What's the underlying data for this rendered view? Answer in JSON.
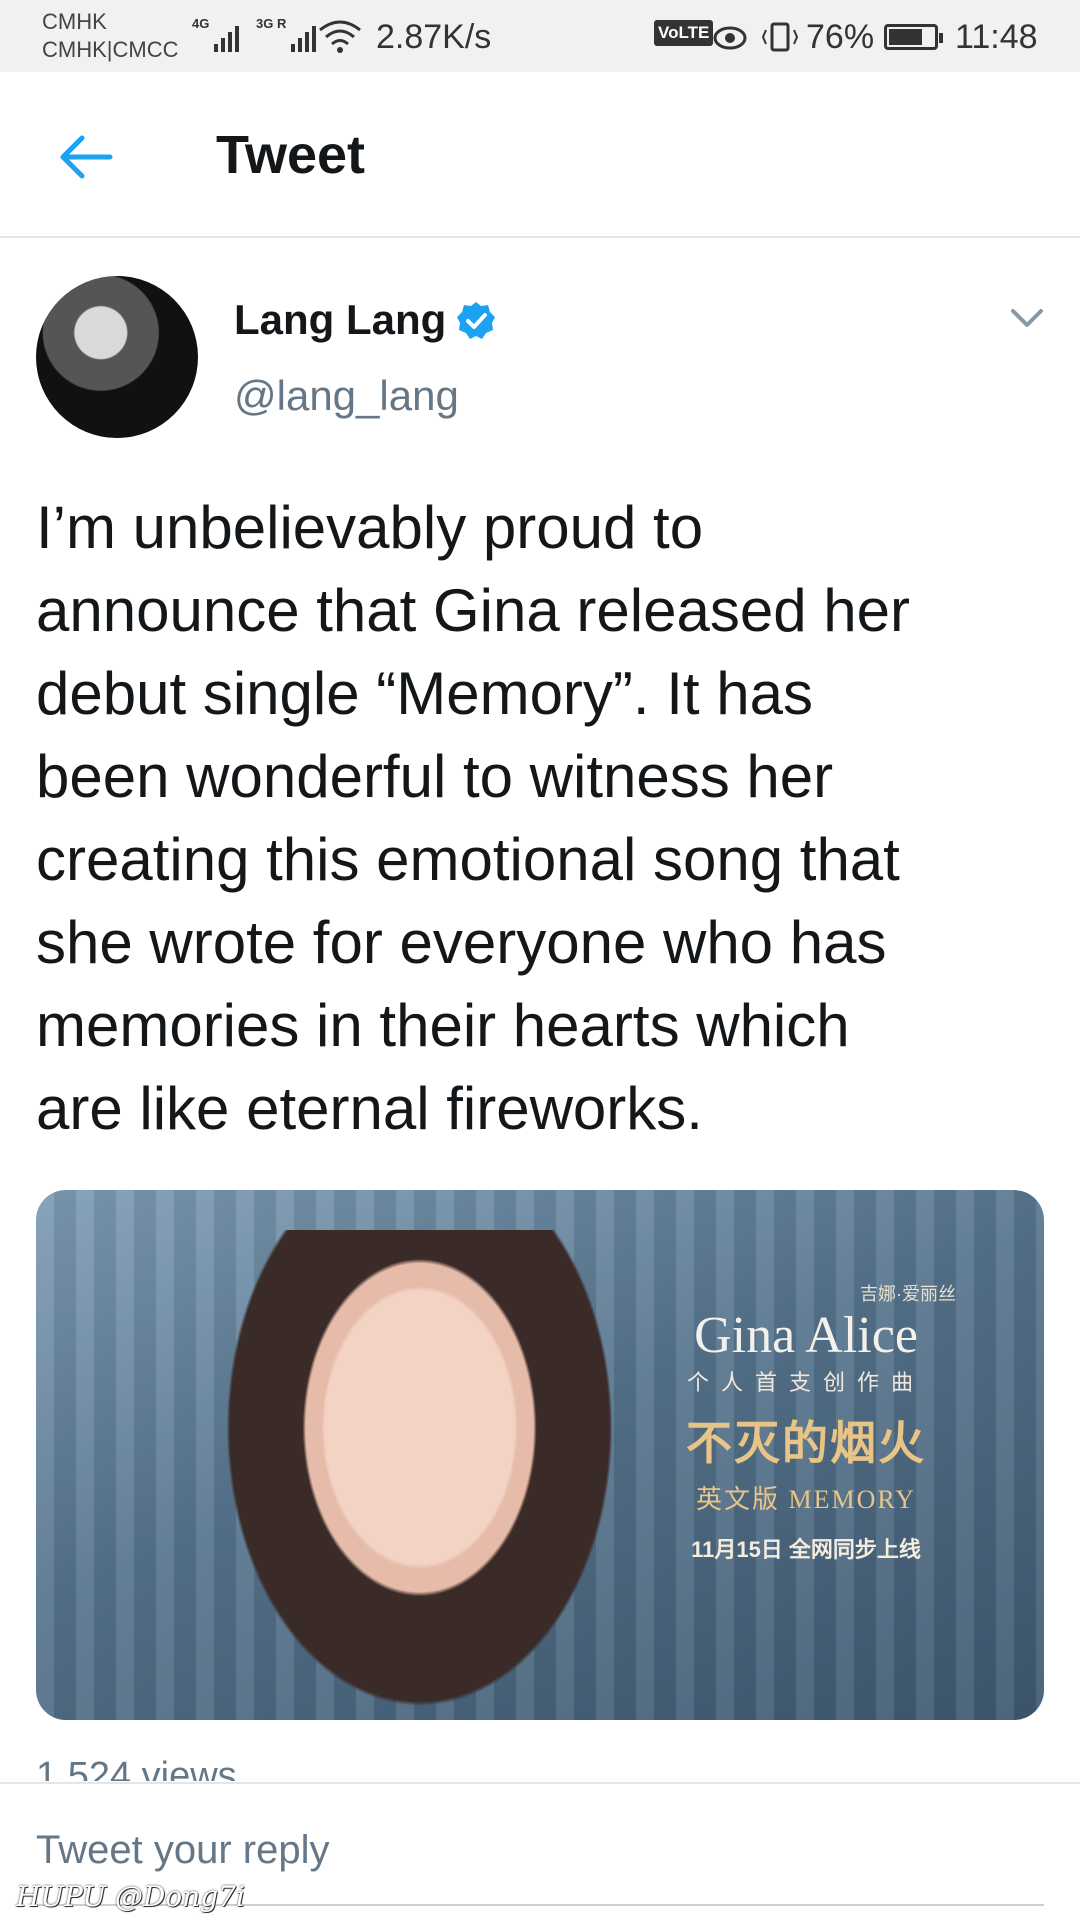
{
  "status_bar": {
    "carrier_1": "CMHK",
    "carrier_2": "CMHK|CMCC",
    "network_1": "4G",
    "network_2": "3G R",
    "net_speed": "2.87K/s",
    "volte": "VoLTE",
    "battery_percent": "76%",
    "battery_level": 0.76,
    "time": "11:48"
  },
  "header": {
    "back_icon": "arrow-left-icon",
    "title": "Tweet",
    "accent_color": "#1da1f2"
  },
  "tweet": {
    "author_name": "Lang Lang",
    "verified": true,
    "handle": "@lang_lang",
    "text": "I’m unbelievably proud to\nannounce that Gina released her\ndebut single “Memory”.  It has\nbeen wonderful to witness her\ncreating this emotional song that\nshe wrote for everyone who has\nmemories in their hearts which\nare like eternal fireworks.",
    "media": {
      "poster_small": "吉娜·爱丽丝",
      "poster_name": "Gina Alice",
      "poster_sub": "个人首支创作曲",
      "poster_title_cn": "不灭的烟火",
      "poster_version": "英文版  MEMORY",
      "poster_date": "11月15日 全网同步上线"
    },
    "views": "1,524 views"
  },
  "reply": {
    "placeholder": "Tweet your reply"
  },
  "watermark": "HUPU @Dong7i"
}
